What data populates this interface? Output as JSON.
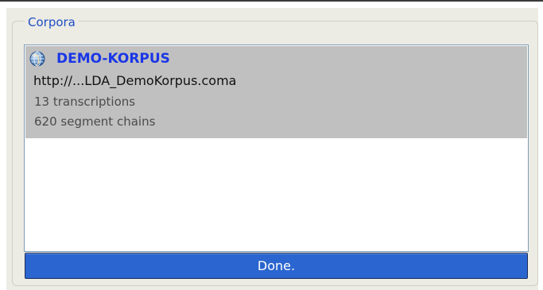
{
  "groupbox": {
    "title": "Corpora"
  },
  "corpus_list": {
    "items": [
      {
        "icon": "globe-icon",
        "name": "DEMO-KORPUS",
        "url": "http://...LDA_DemoKorpus.coma",
        "stats": [
          "13 transcriptions",
          "620 segment chains"
        ]
      }
    ]
  },
  "status": {
    "text": "Done.",
    "progress": 1.0
  },
  "colors": {
    "selected_bg": "#c0c0c0",
    "title_blue": "#1a36e6",
    "legend_blue": "#1f4fc4",
    "status_blue": "#2b65cf"
  }
}
